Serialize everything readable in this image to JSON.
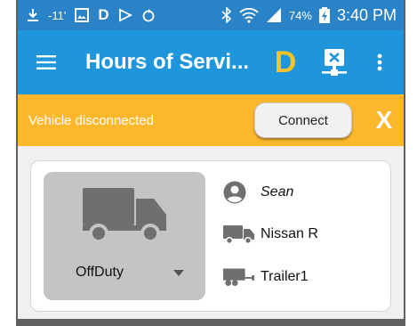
{
  "status_bar": {
    "signal_text": "-11'",
    "letter": "D",
    "battery_percent": "74%",
    "time": "3:40 PM",
    "icons": [
      "download-icon",
      "image-icon",
      "play-outline-icon",
      "sync-icon",
      "bluetooth-icon",
      "wifi-icon",
      "cell-signal-icon",
      "battery-charging-icon"
    ]
  },
  "app_bar": {
    "title": "Hours of Servi...",
    "logo_letter": "D",
    "logo_color": "#f7c325",
    "background": "#1f95dc"
  },
  "banner": {
    "message": "Vehicle disconnected",
    "connect_label": "Connect",
    "close_label": "X",
    "background": "#fcb72d"
  },
  "card": {
    "duty_status": "OffDuty",
    "driver": "Sean",
    "vehicle": "Nissan R",
    "trailer": "Trailer1"
  }
}
